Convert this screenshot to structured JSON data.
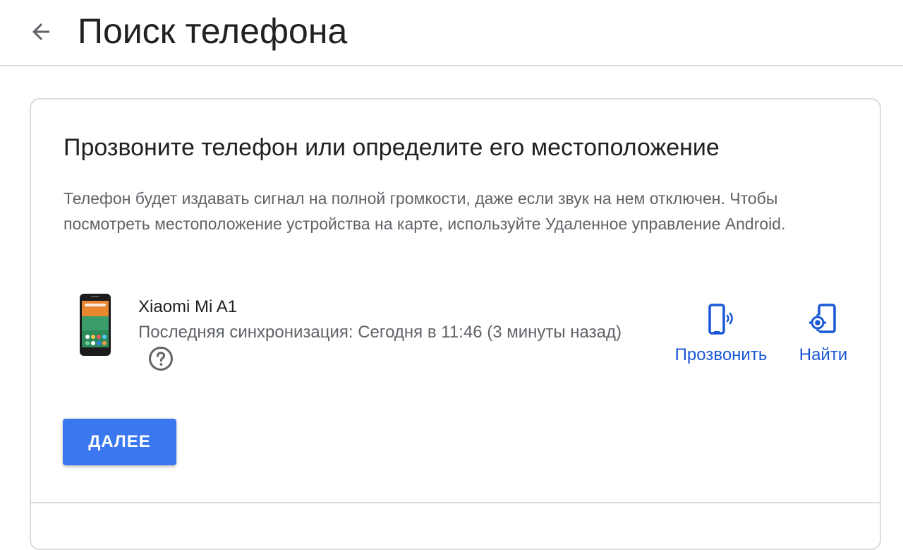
{
  "header": {
    "title": "Поиск телефона",
    "back_icon": "arrow-back-icon"
  },
  "card": {
    "title": "Прозвоните телефон или определите его местоположение",
    "description": "Телефон будет издавать сигнал на полной громкости, даже если звук на нем отключен. Чтобы посмотреть местоположение устройства на карте, используйте Удаленное управление Android.",
    "device": {
      "name": "Xiaomi Mi A1",
      "sync_status": "Последняя синхронизация: Сегодня в 11:46 (3 минуты назад)",
      "image": "phone-image",
      "help_icon": "help-circle-icon"
    },
    "actions": [
      {
        "label": "Прозвонить",
        "icon": "ring-phone-icon"
      },
      {
        "label": "Найти",
        "icon": "locate-phone-icon"
      }
    ],
    "next_button": "ДАЛЕЕ"
  },
  "colors": {
    "accent": "#1a57d6",
    "button_bg": "#3b78f0",
    "title_text": "#202124",
    "secondary_text": "#5f6368",
    "divider": "#dadce0"
  }
}
